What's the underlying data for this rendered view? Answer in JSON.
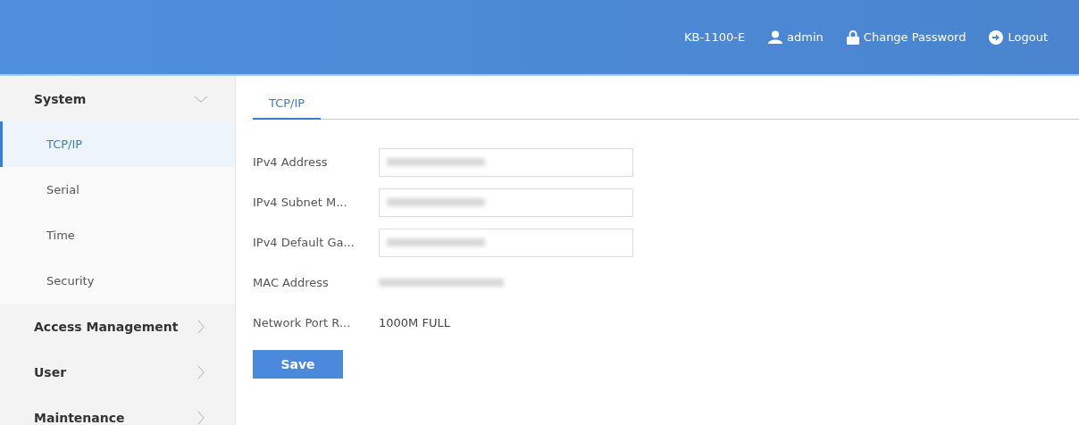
{
  "header": {
    "device": "KB-1100-E",
    "user": "admin",
    "change_password": "Change Password",
    "logout": "Logout"
  },
  "sidebar": {
    "groups": [
      {
        "label": "System",
        "expanded": true,
        "children": [
          {
            "label": "TCP/IP",
            "selected": true
          },
          {
            "label": "Serial",
            "selected": false
          },
          {
            "label": "Time",
            "selected": false
          },
          {
            "label": "Security",
            "selected": false
          }
        ]
      },
      {
        "label": "Access Management",
        "expanded": false
      },
      {
        "label": "User",
        "expanded": false
      },
      {
        "label": "Maintenance",
        "expanded": false
      }
    ]
  },
  "tabs": [
    {
      "label": "TCP/IP",
      "selected": true
    }
  ],
  "form": {
    "rows": [
      {
        "kind": "field",
        "label": "IPv4 Address",
        "redacted": true
      },
      {
        "kind": "field",
        "label": "IPv4 Subnet M...",
        "redacted": true
      },
      {
        "kind": "field",
        "label": "IPv4 Default Ga...",
        "redacted": true
      },
      {
        "kind": "text",
        "label": "MAC Address",
        "redacted": true
      },
      {
        "kind": "text",
        "label": "Network Port R...",
        "value": "1000M FULL"
      }
    ],
    "save": "Save"
  }
}
